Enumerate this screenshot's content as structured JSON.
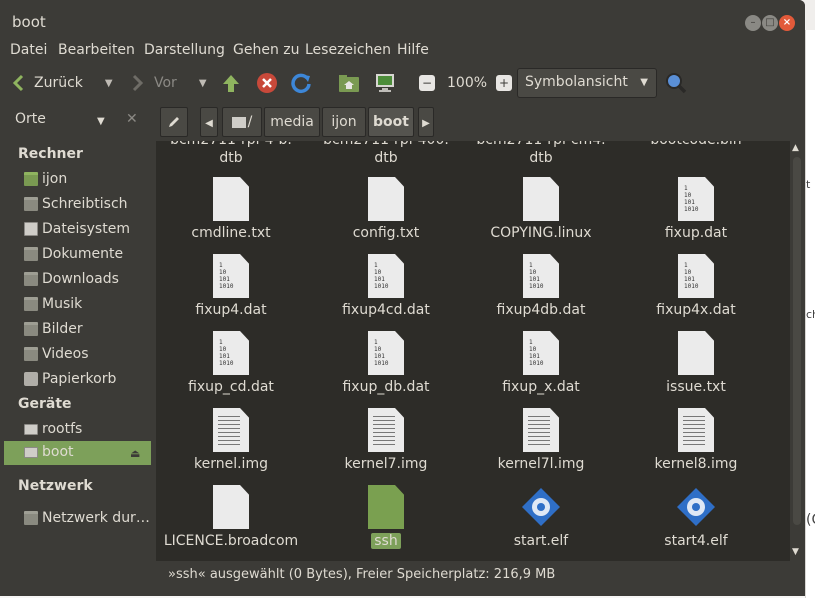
{
  "window": {
    "title": "boot"
  },
  "menu": [
    "Datei",
    "Bearbeiten",
    "Darstellung",
    "Gehen zu",
    "Lesezeichen",
    "Hilfe"
  ],
  "toolbar": {
    "back_label": "Zurück",
    "forward_label": "Vor",
    "zoom": "100%",
    "view_mode": "Symbolansicht"
  },
  "location": {
    "places_label": "Orte",
    "crumbs": [
      "/",
      "media",
      "ijon",
      "boot"
    ]
  },
  "sidebar": {
    "sections": [
      {
        "title": "Rechner",
        "items": [
          "ijon",
          "Schreibtisch",
          "Dateisystem",
          "Dokumente",
          "Downloads",
          "Musik",
          "Bilder",
          "Videos",
          "Papierkorb"
        ]
      },
      {
        "title": "Geräte",
        "items": [
          "rootfs",
          "boot"
        ]
      },
      {
        "title": "Netzwerk",
        "items": [
          "Netzwerk dur…"
        ]
      }
    ]
  },
  "files": {
    "partial_row": [
      "bcm2711-rpi-4-b.\ndtb",
      "bcm2711-rpi-400.\ndtb",
      "bcm2711-rpi-cm4.\ndtb",
      "bootcode.bin"
    ],
    "items": [
      {
        "name": "cmdline.txt",
        "icon": "text-file-icon"
      },
      {
        "name": "config.txt",
        "icon": "text-file-icon"
      },
      {
        "name": "COPYING.linux",
        "icon": "text-file-icon"
      },
      {
        "name": "fixup.dat",
        "icon": "binary-file-icon"
      },
      {
        "name": "fixup4.dat",
        "icon": "binary-file-icon"
      },
      {
        "name": "fixup4cd.dat",
        "icon": "binary-file-icon"
      },
      {
        "name": "fixup4db.dat",
        "icon": "binary-file-icon"
      },
      {
        "name": "fixup4x.dat",
        "icon": "binary-file-icon"
      },
      {
        "name": "fixup_cd.dat",
        "icon": "binary-file-icon"
      },
      {
        "name": "fixup_db.dat",
        "icon": "binary-file-icon"
      },
      {
        "name": "fixup_x.dat",
        "icon": "binary-file-icon"
      },
      {
        "name": "issue.txt",
        "icon": "text-file-icon"
      },
      {
        "name": "kernel.img",
        "icon": "document-file-icon"
      },
      {
        "name": "kernel7.img",
        "icon": "document-file-icon"
      },
      {
        "name": "kernel7l.img",
        "icon": "document-file-icon"
      },
      {
        "name": "kernel8.img",
        "icon": "document-file-icon"
      },
      {
        "name": "LICENCE.broadcom",
        "icon": "text-file-icon"
      },
      {
        "name": "ssh",
        "icon": "selected-file-icon"
      },
      {
        "name": "start.elf",
        "icon": "elf-executable-icon"
      },
      {
        "name": "start4.elf",
        "icon": "elf-executable-icon"
      }
    ]
  },
  "status": "»ssh« ausgewählt (0 Bytes), Freier Speicherplatz: 216,9 MB",
  "colors": {
    "accent": "#7da05a",
    "close": "#e25a3a"
  }
}
